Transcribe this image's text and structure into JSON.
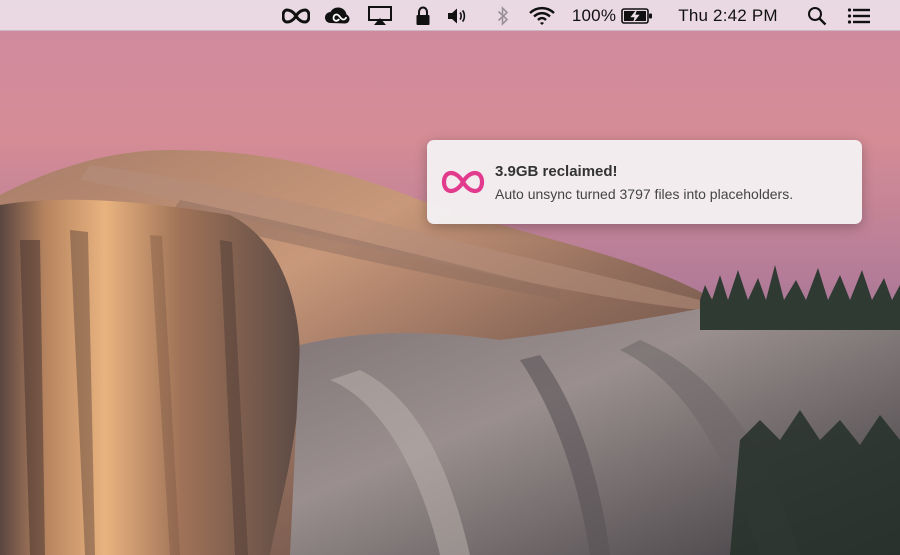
{
  "menubar": {
    "icons": [
      "infinity-icon",
      "creative-cloud-icon",
      "airplay-icon",
      "lock-icon",
      "volume-icon",
      "bluetooth-icon",
      "wifi-icon"
    ],
    "battery_percent": "100%",
    "battery_level": 1.0,
    "clock": "Thu 2:42 PM",
    "right_icons": [
      "spotlight-search-icon",
      "notification-center-icon"
    ]
  },
  "notification": {
    "app_icon": "infinity-icon",
    "accent_color": "#e23a8c",
    "title": "3.9GB reclaimed!",
    "body": "Auto unsync turned 3797 files into placeholders."
  }
}
